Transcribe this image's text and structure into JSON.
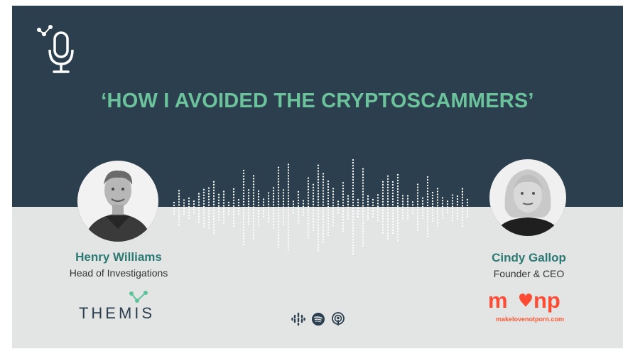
{
  "title": "‘HOW I AVOIDED THE CRYPTOSCAMMERS’",
  "speakers": [
    {
      "name": "Henry Williams",
      "role": "Head of Investigations",
      "org_logo_text": "THEMIS"
    },
    {
      "name": "Cindy Gallop",
      "role": "Founder & CEO",
      "org_logo_text": "mnp",
      "org_url": "makelovenotporn.com"
    }
  ],
  "icons": {
    "podcast": "microphone-icon",
    "platforms": [
      "google-podcasts-icon",
      "spotify-icon",
      "apple-podcasts-icon"
    ]
  },
  "colors": {
    "top_background": "#2c3f4f",
    "bottom_background": "#e3e5e5",
    "title_green": "#6bc39b",
    "name_teal": "#2b7a73",
    "brand_red": "#ff4b33"
  }
}
